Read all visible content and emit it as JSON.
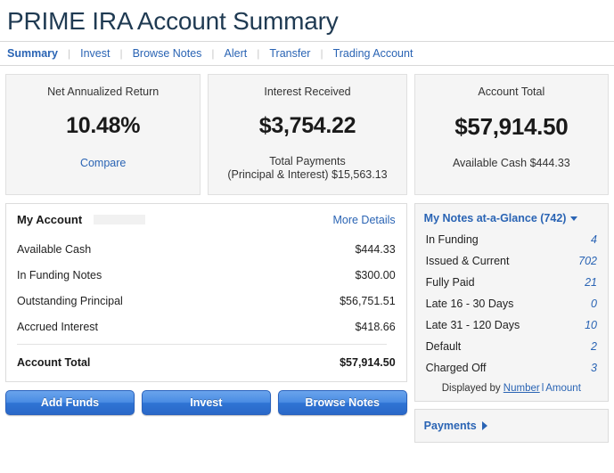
{
  "header": {
    "title": "PRIME IRA Account Summary",
    "nav": [
      {
        "label": "Summary",
        "active": true
      },
      {
        "label": "Invest",
        "active": false
      },
      {
        "label": "Browse Notes",
        "active": false
      },
      {
        "label": "Alert",
        "active": false
      },
      {
        "label": "Transfer",
        "active": false
      },
      {
        "label": "Trading Account",
        "active": false
      }
    ]
  },
  "cards": {
    "net_return": {
      "label": "Net Annualized Return",
      "value": "10.48%",
      "link": "Compare"
    },
    "interest": {
      "label": "Interest Received",
      "value": "$3,754.22",
      "sub_line1": "Total Payments",
      "sub_line2": "(Principal & Interest) $15,563.13"
    },
    "account_total": {
      "label": "Account Total",
      "value": "$57,914.50",
      "sub_line1": "Available Cash $444.33"
    }
  },
  "my_account": {
    "title": "My Account",
    "more_details": "More Details",
    "rows": [
      {
        "label": "Available Cash",
        "value": "$444.33"
      },
      {
        "label": "In Funding Notes",
        "value": "$300.00"
      },
      {
        "label": "Outstanding Principal",
        "value": "$56,751.51"
      },
      {
        "label": "Accrued Interest",
        "value": "$418.66"
      }
    ],
    "total_label": "Account Total",
    "total_value": "$57,914.50"
  },
  "buttons": {
    "add_funds": "Add Funds",
    "invest": "Invest",
    "browse_notes": "Browse Notes"
  },
  "notes_glance": {
    "title": "My Notes at-a-Glance (742)",
    "rows": [
      {
        "label": "In Funding",
        "value": "4"
      },
      {
        "label": "Issued & Current",
        "value": "702"
      },
      {
        "label": "Fully Paid",
        "value": "21"
      },
      {
        "label": "Late 16 - 30 Days",
        "value": "0"
      },
      {
        "label": "Late 31 - 120 Days",
        "value": "10"
      },
      {
        "label": "Default",
        "value": "2"
      },
      {
        "label": "Charged Off",
        "value": "3"
      }
    ],
    "displayed_by_label": "Displayed by",
    "displayed_by_number": "Number",
    "displayed_by_separator": "l",
    "displayed_by_amount": "Amount"
  },
  "payments": {
    "label": "Payments"
  },
  "colors": {
    "link_blue": "#2a64b4",
    "title_navy": "#1f3a52",
    "button_blue": "#3d7fdc",
    "card_bg": "#f5f5f5"
  }
}
